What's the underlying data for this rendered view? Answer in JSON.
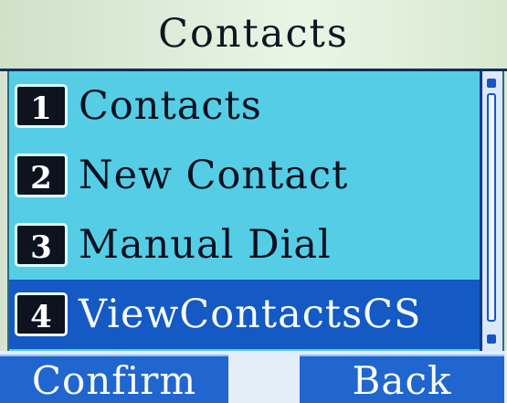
{
  "header": {
    "title": "Contacts"
  },
  "menu": {
    "items": [
      {
        "number": "1",
        "label": "Contacts",
        "selected": false
      },
      {
        "number": "2",
        "label": "New Contact",
        "selected": false
      },
      {
        "number": "3",
        "label": "Manual Dial",
        "selected": false
      },
      {
        "number": "4",
        "label": "ViewContactsCS",
        "selected": true
      }
    ]
  },
  "softkeys": {
    "left": "Confirm",
    "right": "Back"
  },
  "colors": {
    "list_background": "#55cde5",
    "selected_background": "#1459c4",
    "softkey_background": "#2165cf"
  }
}
